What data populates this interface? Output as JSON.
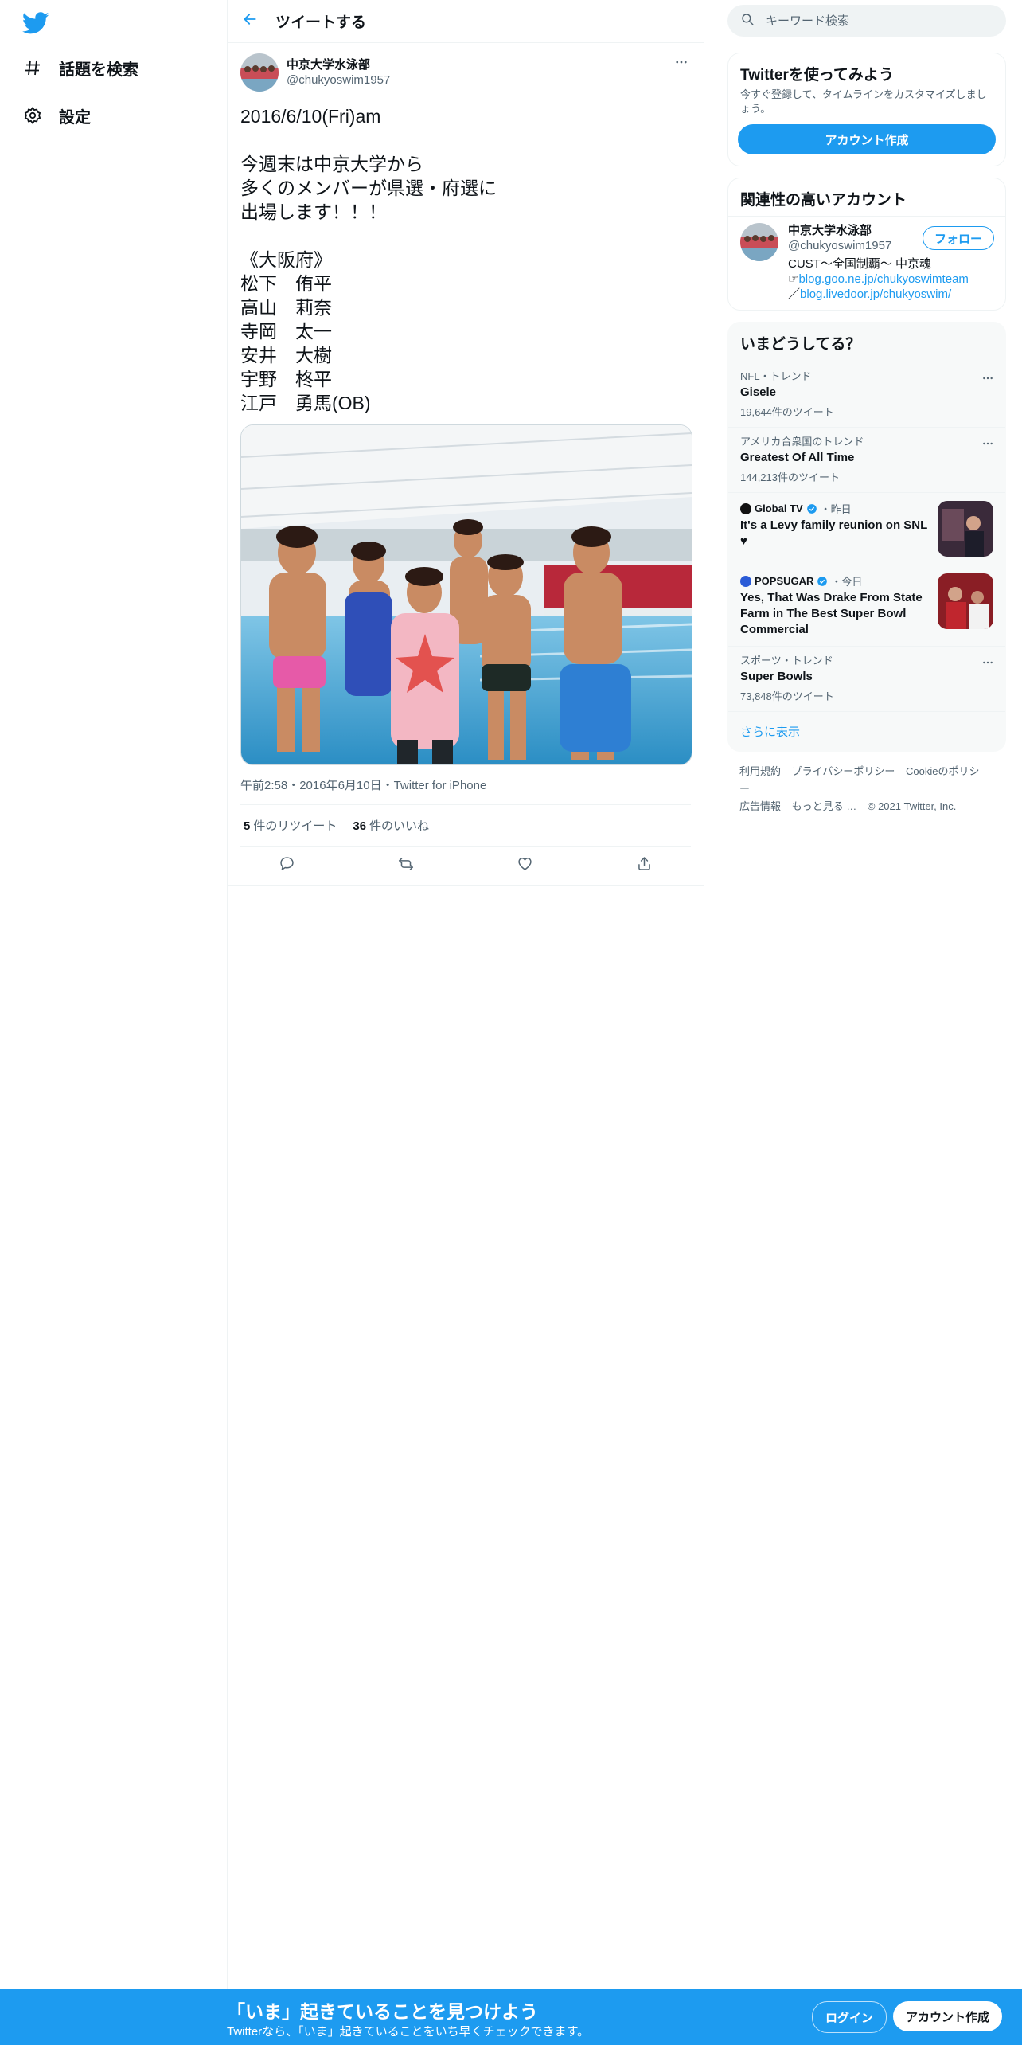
{
  "nav": {
    "logo_icon": "twitter-bird-icon",
    "items": [
      {
        "icon": "hashtag-icon",
        "label": "話題を検索"
      },
      {
        "icon": "gear-icon",
        "label": "設定"
      }
    ]
  },
  "header": {
    "back_icon": "arrow-left-icon",
    "title": "ツイートする"
  },
  "tweet": {
    "author_name": "中京大学水泳部",
    "author_handle": "@chukyoswim1957",
    "text": "2016/6/10(Fri)am\n\n今週末は中京大学から\n多くのメンバーが県選・府選に\n出場します！！！\n\n《大阪府》\n松下　侑平\n高山　莉奈\n寺岡　太一\n安井　大樹\n宇野　柊平\n江戸　勇馬(OB)",
    "meta": "午前2:58・2016年6月10日・Twitter for iPhone",
    "retweets_count": "5",
    "retweets_label": "件のリツイート",
    "likes_count": "36",
    "likes_label": "件のいいね",
    "actions": [
      "reply-icon",
      "retweet-icon",
      "like-icon",
      "share-icon"
    ]
  },
  "search": {
    "placeholder": "キーワード検索"
  },
  "signup_card": {
    "title": "Twitterを使ってみよう",
    "subtitle": "今すぐ登録して、タイムラインをカスタマイズしましょう。",
    "button": "アカウント作成"
  },
  "relevant": {
    "title": "関連性の高いアカウント",
    "name": "中京大学水泳部",
    "handle": "@chukyoswim1957",
    "follow": "フォロー",
    "bio_line1": "CUST〜全国制覇〜 中京魂",
    "bio_line2_prefix": "☞",
    "bio_line2_link": "blog.goo.ne.jp/chukyoswimteam",
    "bio_line3_prefix": "／",
    "bio_line3_link": "blog.livedoor.jp/chukyoswim/"
  },
  "trends": {
    "title": "いまどうしてる？",
    "items": [
      {
        "meta": "NFL・トレンド",
        "title": "Gisele",
        "count": "19,644件のツイート"
      },
      {
        "meta": "アメリカ合衆国のトレンド",
        "title": "Greatest Of All Time",
        "count": "144,213件のツイート"
      }
    ],
    "news": [
      {
        "source": "Global TV",
        "time": "・昨日",
        "title": "It's a Levy family reunion on SNL ♥"
      },
      {
        "source": "POPSUGAR",
        "time": "・今日",
        "title": "Yes, That Was Drake From State Farm in The Best Super Bowl Commercial"
      }
    ],
    "last": {
      "meta": "スポーツ・トレンド",
      "title": "Super Bowls",
      "count": "73,848件のツイート"
    },
    "show_more": "さらに表示"
  },
  "footer": {
    "links": [
      "利用規約",
      "プライバシーポリシー",
      "Cookieのポリシー",
      "広告情報",
      "もっと見る …",
      "© 2021 Twitter, Inc."
    ]
  },
  "bottom_bar": {
    "title": "「いま」起きていることを見つけよう",
    "subtitle": "Twitterなら、「いま」起きていることをいち早くチェックできます。",
    "login": "ログイン",
    "signup": "アカウント作成"
  },
  "colors": {
    "accent": "#1d9bf0",
    "text": "#0f1419",
    "muted": "#536471",
    "like_heart": "#e0245e"
  }
}
